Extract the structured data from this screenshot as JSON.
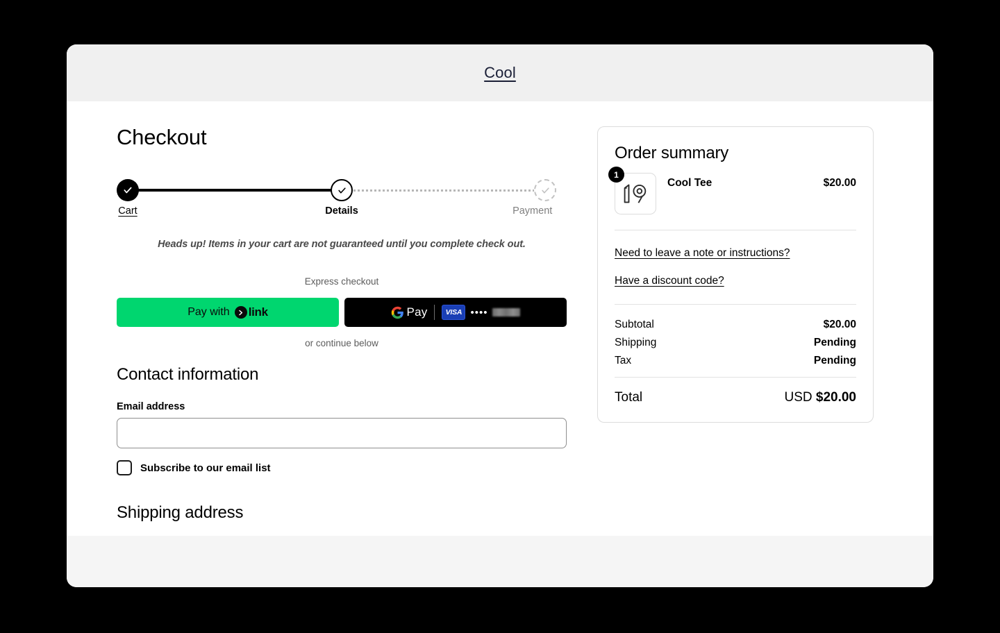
{
  "store": {
    "name": "Cool"
  },
  "page": {
    "title": "Checkout",
    "notice": "Heads up! Items in your cart are not guaranteed until you complete check out."
  },
  "stepper": {
    "steps": [
      {
        "label": "Cart",
        "state": "completed",
        "icon": "check-icon"
      },
      {
        "label": "Details",
        "state": "current",
        "icon": "check-icon"
      },
      {
        "label": "Payment",
        "state": "upcoming",
        "icon": "check-icon"
      }
    ]
  },
  "express": {
    "label": "Express checkout",
    "continue_below": "or continue below",
    "link_button": {
      "prefix": "Pay with",
      "brand": "link",
      "icon": "link-chevron-icon",
      "color": "#00d66f"
    },
    "gpay_button": {
      "logo_g": "G",
      "pay_label": "Pay",
      "card_brand": "VISA",
      "card_dots": "••••",
      "card_last4_redacted": true,
      "color": "#000000"
    }
  },
  "contact": {
    "section_title": "Contact information",
    "email_label": "Email address",
    "email_value": "",
    "email_placeholder": "",
    "subscribe_label": "Subscribe to our email list",
    "subscribe_checked": false
  },
  "shipping": {
    "section_title": "Shipping address"
  },
  "summary": {
    "title": "Order summary",
    "items": [
      {
        "name": "Cool Tee",
        "price": "$20.00",
        "quantity": "1",
        "thumbnail": "product-thumbnail-19"
      }
    ],
    "links": [
      {
        "label": "Need to leave a note or instructions?"
      },
      {
        "label": "Have a discount code?"
      }
    ],
    "totals": [
      {
        "label": "Subtotal",
        "value": "$20.00"
      },
      {
        "label": "Shipping",
        "value": "Pending"
      },
      {
        "label": "Tax",
        "value": "Pending"
      }
    ],
    "grand_total": {
      "label": "Total",
      "currency": "USD",
      "amount": "$20.00"
    }
  }
}
